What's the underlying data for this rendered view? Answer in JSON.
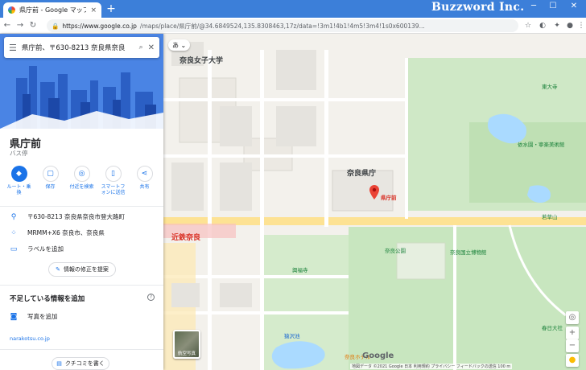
{
  "browser": {
    "tab_title": "県庁前 - Google マップ",
    "tab_close": "×",
    "new_tab": "+",
    "brand": "Buzzword Inc.",
    "url_host": "https://www.google.co.jp",
    "url_rest": "/maps/place/県庁前/@34.6849524,135.8308463,17z/data=!3m1!4b1!4m5!3m4!1s0x600139...",
    "controls": {
      "min": "─",
      "max": "☐",
      "close": "✕"
    }
  },
  "panel": {
    "search_value": "県庁前、〒630-8213 奈良県奈良",
    "title": "県庁前",
    "subtitle": "バス停",
    "actions": [
      {
        "label": "ルート・乗換",
        "icon": "◆"
      },
      {
        "label": "保存",
        "icon": "▢"
      },
      {
        "label": "付近を検索",
        "icon": "◎"
      },
      {
        "label": "スマートフォンに送信",
        "icon": "▯"
      },
      {
        "label": "共有",
        "icon": "⋖"
      }
    ],
    "address": "〒630-8213 奈良県奈良市登大路町",
    "pluscode": "MRMM+X6 奈良市、奈良県",
    "add_label": "ラベルを追加",
    "suggest_edit": "情報の修正を提案",
    "missing_title": "不足している情報を追加",
    "add_photo": "写真を追加",
    "site_url": "narakotsu.co.jp",
    "write_review": "クチコミを書く"
  },
  "map": {
    "chip_a": "あ",
    "labels": {
      "nara_womens_univ": "奈良女子大学",
      "kintetsu_nara": "近鉄奈良",
      "nara_park": "奈良公園",
      "kokuritsu": "奈良国立博物館",
      "kencho": "奈良県庁",
      "kenchomae": "県庁前",
      "todaiji": "東大寺",
      "kofukuji": "興福寺",
      "sarusawa": "猿沢池",
      "yoshikien": "依水園・寧楽美術館",
      "wakakusa": "若草山",
      "nara_hotel": "奈良ホテル",
      "kasuga": "春日大社"
    },
    "satellite": "航空写真",
    "attribution": "地図データ ©2021 Google 日本 利用規約 プライバシー フィードバックの送信 100 m",
    "google": "Google"
  }
}
